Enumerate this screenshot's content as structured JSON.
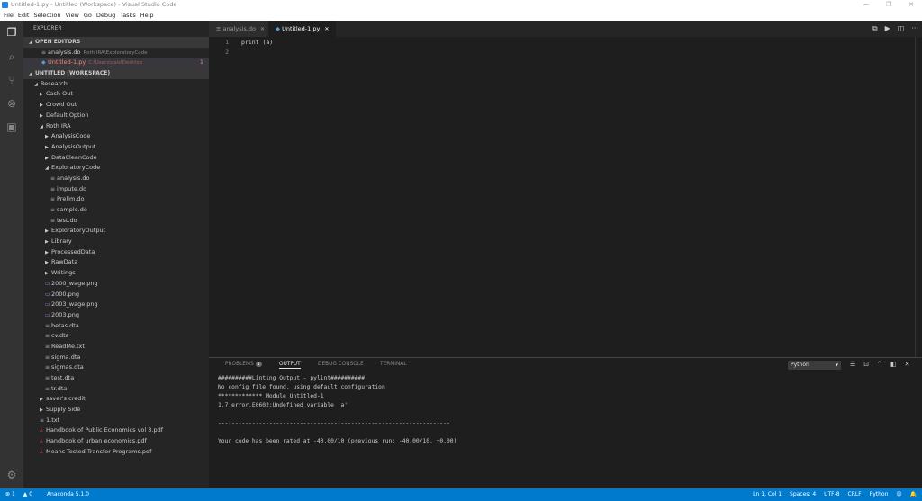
{
  "window": {
    "title": "Untitled-1.py - Untitled (Workspace) - Visual Studio Code",
    "min": "—",
    "max": "❐",
    "close": "✕"
  },
  "menu": [
    "File",
    "Edit",
    "Selection",
    "View",
    "Go",
    "Debug",
    "Tasks",
    "Help"
  ],
  "sidebar": {
    "title": "EXPLORER",
    "open_editors_label": "OPEN EDITORS",
    "open_editors": [
      {
        "name": "analysis.do",
        "desc": "Roth IRA\\ExploratoryCode",
        "icon": "file-icon"
      },
      {
        "name": "Untitled-1.py",
        "desc": "C:\\Users\\cais\\Desktop",
        "icon": "python-icon",
        "errors": "1"
      }
    ],
    "workspace_label": "UNTITLED (WORKSPACE)",
    "tree": [
      {
        "name": "Research",
        "level": 0,
        "type": "folder",
        "open": true
      },
      {
        "name": "Cash Out",
        "level": 1,
        "type": "folder"
      },
      {
        "name": "Crowd Out",
        "level": 1,
        "type": "folder"
      },
      {
        "name": "Default Option",
        "level": 1,
        "type": "folder"
      },
      {
        "name": "Roth IRA",
        "level": 1,
        "type": "folder",
        "open": true
      },
      {
        "name": "AnalysisCode",
        "level": 2,
        "type": "folder"
      },
      {
        "name": "AnalysisOutput",
        "level": 2,
        "type": "folder"
      },
      {
        "name": "DataCleanCode",
        "level": 2,
        "type": "folder"
      },
      {
        "name": "ExploratoryCode",
        "level": 2,
        "type": "folder",
        "open": true
      },
      {
        "name": "analysis.do",
        "level": 3,
        "type": "file"
      },
      {
        "name": "impute.do",
        "level": 3,
        "type": "file"
      },
      {
        "name": "Prelim.do",
        "level": 3,
        "type": "file"
      },
      {
        "name": "sample.do",
        "level": 3,
        "type": "file"
      },
      {
        "name": "test.do",
        "level": 3,
        "type": "file"
      },
      {
        "name": "ExploratoryOutput",
        "level": 2,
        "type": "folder"
      },
      {
        "name": "Library",
        "level": 2,
        "type": "folder"
      },
      {
        "name": "ProcessedData",
        "level": 2,
        "type": "folder"
      },
      {
        "name": "RawData",
        "level": 2,
        "type": "folder"
      },
      {
        "name": "Writings",
        "level": 2,
        "type": "folder"
      },
      {
        "name": "2000_wage.png",
        "level": 2,
        "type": "image"
      },
      {
        "name": "2000.png",
        "level": 2,
        "type": "image"
      },
      {
        "name": "2003_wage.png",
        "level": 2,
        "type": "image"
      },
      {
        "name": "2003.png",
        "level": 2,
        "type": "image"
      },
      {
        "name": "betas.dta",
        "level": 2,
        "type": "file"
      },
      {
        "name": "cv.dta",
        "level": 2,
        "type": "file"
      },
      {
        "name": "ReadMe.txt",
        "level": 2,
        "type": "file"
      },
      {
        "name": "sigma.dta",
        "level": 2,
        "type": "file"
      },
      {
        "name": "sigmas.dta",
        "level": 2,
        "type": "file"
      },
      {
        "name": "test.dta",
        "level": 2,
        "type": "file"
      },
      {
        "name": "tr.dta",
        "level": 2,
        "type": "file"
      },
      {
        "name": "saver's credit",
        "level": 1,
        "type": "folder"
      },
      {
        "name": "Supply Side",
        "level": 1,
        "type": "folder"
      },
      {
        "name": "1.txt",
        "level": 1,
        "type": "file"
      },
      {
        "name": "Handbook of Public Economics vol 3.pdf",
        "level": 1,
        "type": "pdf"
      },
      {
        "name": "Handbook of urban economics.pdf",
        "level": 1,
        "type": "pdf"
      },
      {
        "name": "Means-Tested Transfer Programs.pdf",
        "level": 1,
        "type": "pdf"
      }
    ]
  },
  "tabs": [
    {
      "label": "analysis.do",
      "active": false
    },
    {
      "label": "Untitled-1.py",
      "active": true
    }
  ],
  "editor": {
    "lines": [
      "print (a)",
      ""
    ]
  },
  "panel": {
    "tabs": [
      "PROBLEMS",
      "OUTPUT",
      "DEBUG CONSOLE",
      "TERMINAL"
    ],
    "problems_count": "1",
    "active": "OUTPUT",
    "channel": "Python",
    "output": "##########Linting Output - pylint##########\nNo config file found, using default configuration\n************* Module Untitled-1\n1,7,error,E0602:Undefined variable 'a'\n\n--------------------------------------------------------------------\n\nYour code has been rated at -40.00/10 (previous run: -40.00/10, +0.00)"
  },
  "status": {
    "errors": "1",
    "warnings": "0",
    "interpreter": "Anaconda 5.1.0",
    "position": "Ln 1, Col 1",
    "spaces": "Spaces: 4",
    "encoding": "UTF-8",
    "eol": "CRLF",
    "language": "Python"
  },
  "colors": {
    "accent": "#007acc",
    "error": "#f48771"
  }
}
